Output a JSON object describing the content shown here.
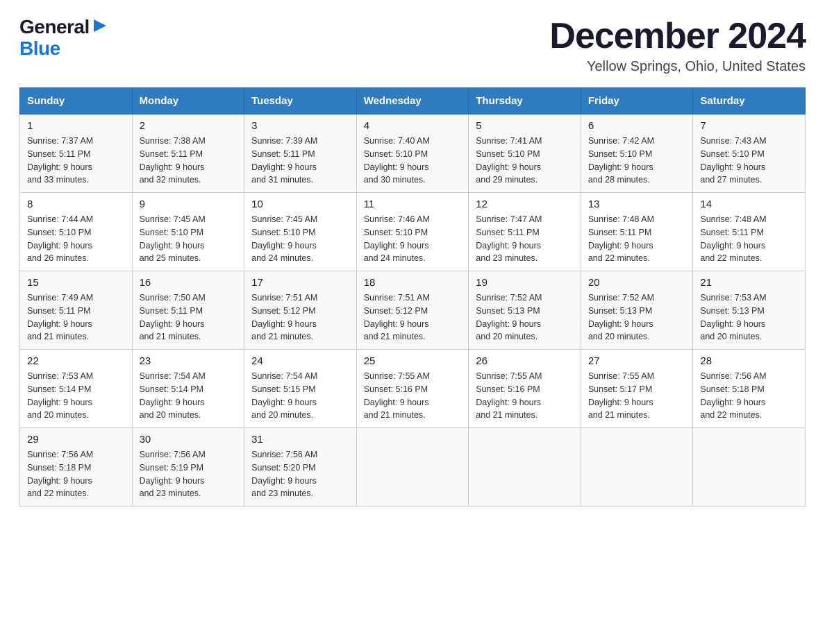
{
  "logo": {
    "general": "General",
    "blue": "Blue",
    "arrow": "▶"
  },
  "title": "December 2024",
  "subtitle": "Yellow Springs, Ohio, United States",
  "days_of_week": [
    "Sunday",
    "Monday",
    "Tuesday",
    "Wednesday",
    "Thursday",
    "Friday",
    "Saturday"
  ],
  "weeks": [
    [
      {
        "day": "1",
        "sunrise": "7:37 AM",
        "sunset": "5:11 PM",
        "daylight": "9 hours and 33 minutes."
      },
      {
        "day": "2",
        "sunrise": "7:38 AM",
        "sunset": "5:11 PM",
        "daylight": "9 hours and 32 minutes."
      },
      {
        "day": "3",
        "sunrise": "7:39 AM",
        "sunset": "5:11 PM",
        "daylight": "9 hours and 31 minutes."
      },
      {
        "day": "4",
        "sunrise": "7:40 AM",
        "sunset": "5:10 PM",
        "daylight": "9 hours and 30 minutes."
      },
      {
        "day": "5",
        "sunrise": "7:41 AM",
        "sunset": "5:10 PM",
        "daylight": "9 hours and 29 minutes."
      },
      {
        "day": "6",
        "sunrise": "7:42 AM",
        "sunset": "5:10 PM",
        "daylight": "9 hours and 28 minutes."
      },
      {
        "day": "7",
        "sunrise": "7:43 AM",
        "sunset": "5:10 PM",
        "daylight": "9 hours and 27 minutes."
      }
    ],
    [
      {
        "day": "8",
        "sunrise": "7:44 AM",
        "sunset": "5:10 PM",
        "daylight": "9 hours and 26 minutes."
      },
      {
        "day": "9",
        "sunrise": "7:45 AM",
        "sunset": "5:10 PM",
        "daylight": "9 hours and 25 minutes."
      },
      {
        "day": "10",
        "sunrise": "7:45 AM",
        "sunset": "5:10 PM",
        "daylight": "9 hours and 24 minutes."
      },
      {
        "day": "11",
        "sunrise": "7:46 AM",
        "sunset": "5:10 PM",
        "daylight": "9 hours and 24 minutes."
      },
      {
        "day": "12",
        "sunrise": "7:47 AM",
        "sunset": "5:11 PM",
        "daylight": "9 hours and 23 minutes."
      },
      {
        "day": "13",
        "sunrise": "7:48 AM",
        "sunset": "5:11 PM",
        "daylight": "9 hours and 22 minutes."
      },
      {
        "day": "14",
        "sunrise": "7:48 AM",
        "sunset": "5:11 PM",
        "daylight": "9 hours and 22 minutes."
      }
    ],
    [
      {
        "day": "15",
        "sunrise": "7:49 AM",
        "sunset": "5:11 PM",
        "daylight": "9 hours and 21 minutes."
      },
      {
        "day": "16",
        "sunrise": "7:50 AM",
        "sunset": "5:11 PM",
        "daylight": "9 hours and 21 minutes."
      },
      {
        "day": "17",
        "sunrise": "7:51 AM",
        "sunset": "5:12 PM",
        "daylight": "9 hours and 21 minutes."
      },
      {
        "day": "18",
        "sunrise": "7:51 AM",
        "sunset": "5:12 PM",
        "daylight": "9 hours and 21 minutes."
      },
      {
        "day": "19",
        "sunrise": "7:52 AM",
        "sunset": "5:13 PM",
        "daylight": "9 hours and 20 minutes."
      },
      {
        "day": "20",
        "sunrise": "7:52 AM",
        "sunset": "5:13 PM",
        "daylight": "9 hours and 20 minutes."
      },
      {
        "day": "21",
        "sunrise": "7:53 AM",
        "sunset": "5:13 PM",
        "daylight": "9 hours and 20 minutes."
      }
    ],
    [
      {
        "day": "22",
        "sunrise": "7:53 AM",
        "sunset": "5:14 PM",
        "daylight": "9 hours and 20 minutes."
      },
      {
        "day": "23",
        "sunrise": "7:54 AM",
        "sunset": "5:14 PM",
        "daylight": "9 hours and 20 minutes."
      },
      {
        "day": "24",
        "sunrise": "7:54 AM",
        "sunset": "5:15 PM",
        "daylight": "9 hours and 20 minutes."
      },
      {
        "day": "25",
        "sunrise": "7:55 AM",
        "sunset": "5:16 PM",
        "daylight": "9 hours and 21 minutes."
      },
      {
        "day": "26",
        "sunrise": "7:55 AM",
        "sunset": "5:16 PM",
        "daylight": "9 hours and 21 minutes."
      },
      {
        "day": "27",
        "sunrise": "7:55 AM",
        "sunset": "5:17 PM",
        "daylight": "9 hours and 21 minutes."
      },
      {
        "day": "28",
        "sunrise": "7:56 AM",
        "sunset": "5:18 PM",
        "daylight": "9 hours and 22 minutes."
      }
    ],
    [
      {
        "day": "29",
        "sunrise": "7:56 AM",
        "sunset": "5:18 PM",
        "daylight": "9 hours and 22 minutes."
      },
      {
        "day": "30",
        "sunrise": "7:56 AM",
        "sunset": "5:19 PM",
        "daylight": "9 hours and 23 minutes."
      },
      {
        "day": "31",
        "sunrise": "7:56 AM",
        "sunset": "5:20 PM",
        "daylight": "9 hours and 23 minutes."
      },
      null,
      null,
      null,
      null
    ]
  ]
}
